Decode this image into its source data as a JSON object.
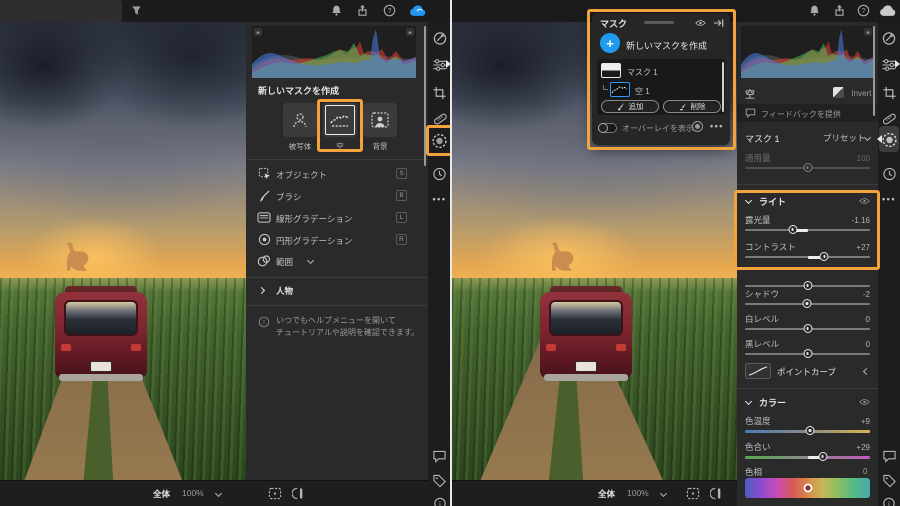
{
  "left": {
    "panel": {
      "create_title": "新しいマスクを作成",
      "type_subject": "被写体",
      "type_sky": "空",
      "type_background": "背景",
      "tool_object": "オブジェクト",
      "tool_object_key": "S",
      "tool_brush": "ブラシ",
      "tool_brush_key": "B",
      "tool_linear": "線形グラデーション",
      "tool_linear_key": "L",
      "tool_radial": "円形グラデーション",
      "tool_radial_key": "R",
      "tool_range": "範囲",
      "people": "人物",
      "hint1": "いつでもヘルプメニューを開いて",
      "hint2": "チュートリアルや説明を確認できます。"
    },
    "bottom": {
      "scope": "全体",
      "zoom": "100%"
    }
  },
  "right": {
    "popup": {
      "title": "マスク",
      "create": "新しいマスクを作成",
      "plus": "+",
      "mask1": "マスク 1",
      "mask2": "空 1",
      "add": "追加",
      "subtract": "削除",
      "overlay": "オーバーレイを表示"
    },
    "panel": {
      "mask_name": "空",
      "invert": "Invert",
      "feedback": "フィードバックを提供",
      "mask_title": "マスク 1",
      "preset": "プリセット",
      "amount_label": "適用量",
      "amount_value": "100",
      "light": "ライト",
      "exposure": "露光量",
      "exposure_value": "-1.16",
      "contrast": "コントラスト",
      "contrast_value": "+27",
      "shadows": "シャドウ",
      "shadows_value": "-2",
      "whites": "白レベル",
      "whites_value": "0",
      "blacks": "黒レベル",
      "blacks_value": "0",
      "point_curve": "ポイントカーブ",
      "color": "カラー",
      "temp": "色温度",
      "temp_value": "+9",
      "tint": "色合い",
      "tint_value": "+29",
      "hue": "色相",
      "hue_value": "0"
    },
    "bottom": {
      "scope": "全体",
      "zoom": "100%"
    }
  },
  "colors": {
    "annotation_orange": "#F2A33C",
    "accent_blue": "#2296F3",
    "selection_blue": "#2D96FF"
  }
}
